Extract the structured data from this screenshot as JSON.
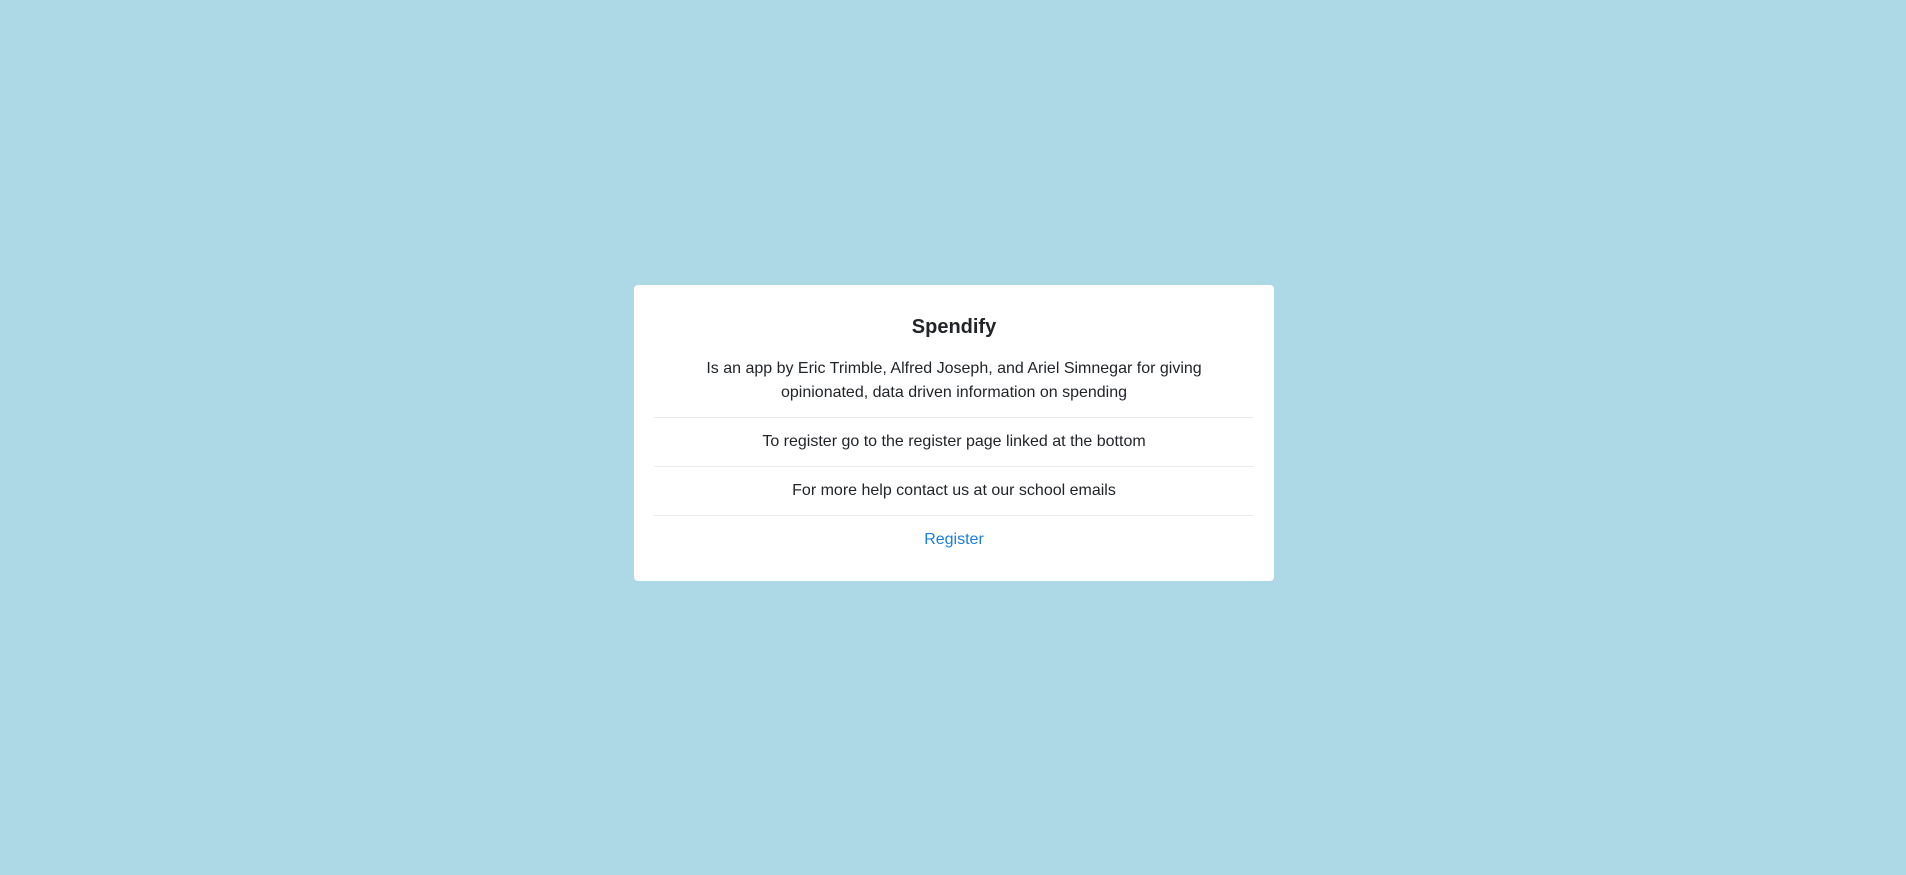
{
  "card": {
    "title": "Spendify",
    "description": "Is an app by Eric Trimble, Alfred Joseph, and Ariel Simnegar for giving opinionated, data driven information on spending",
    "register_info": "To register go to the register page linked at the bottom",
    "help_info": "For more help contact us at our school emails",
    "register_link": "Register"
  },
  "colors": {
    "background": "#add8e6",
    "card": "#ffffff",
    "link": "#1a7de0",
    "divider": "#e9ecef"
  }
}
